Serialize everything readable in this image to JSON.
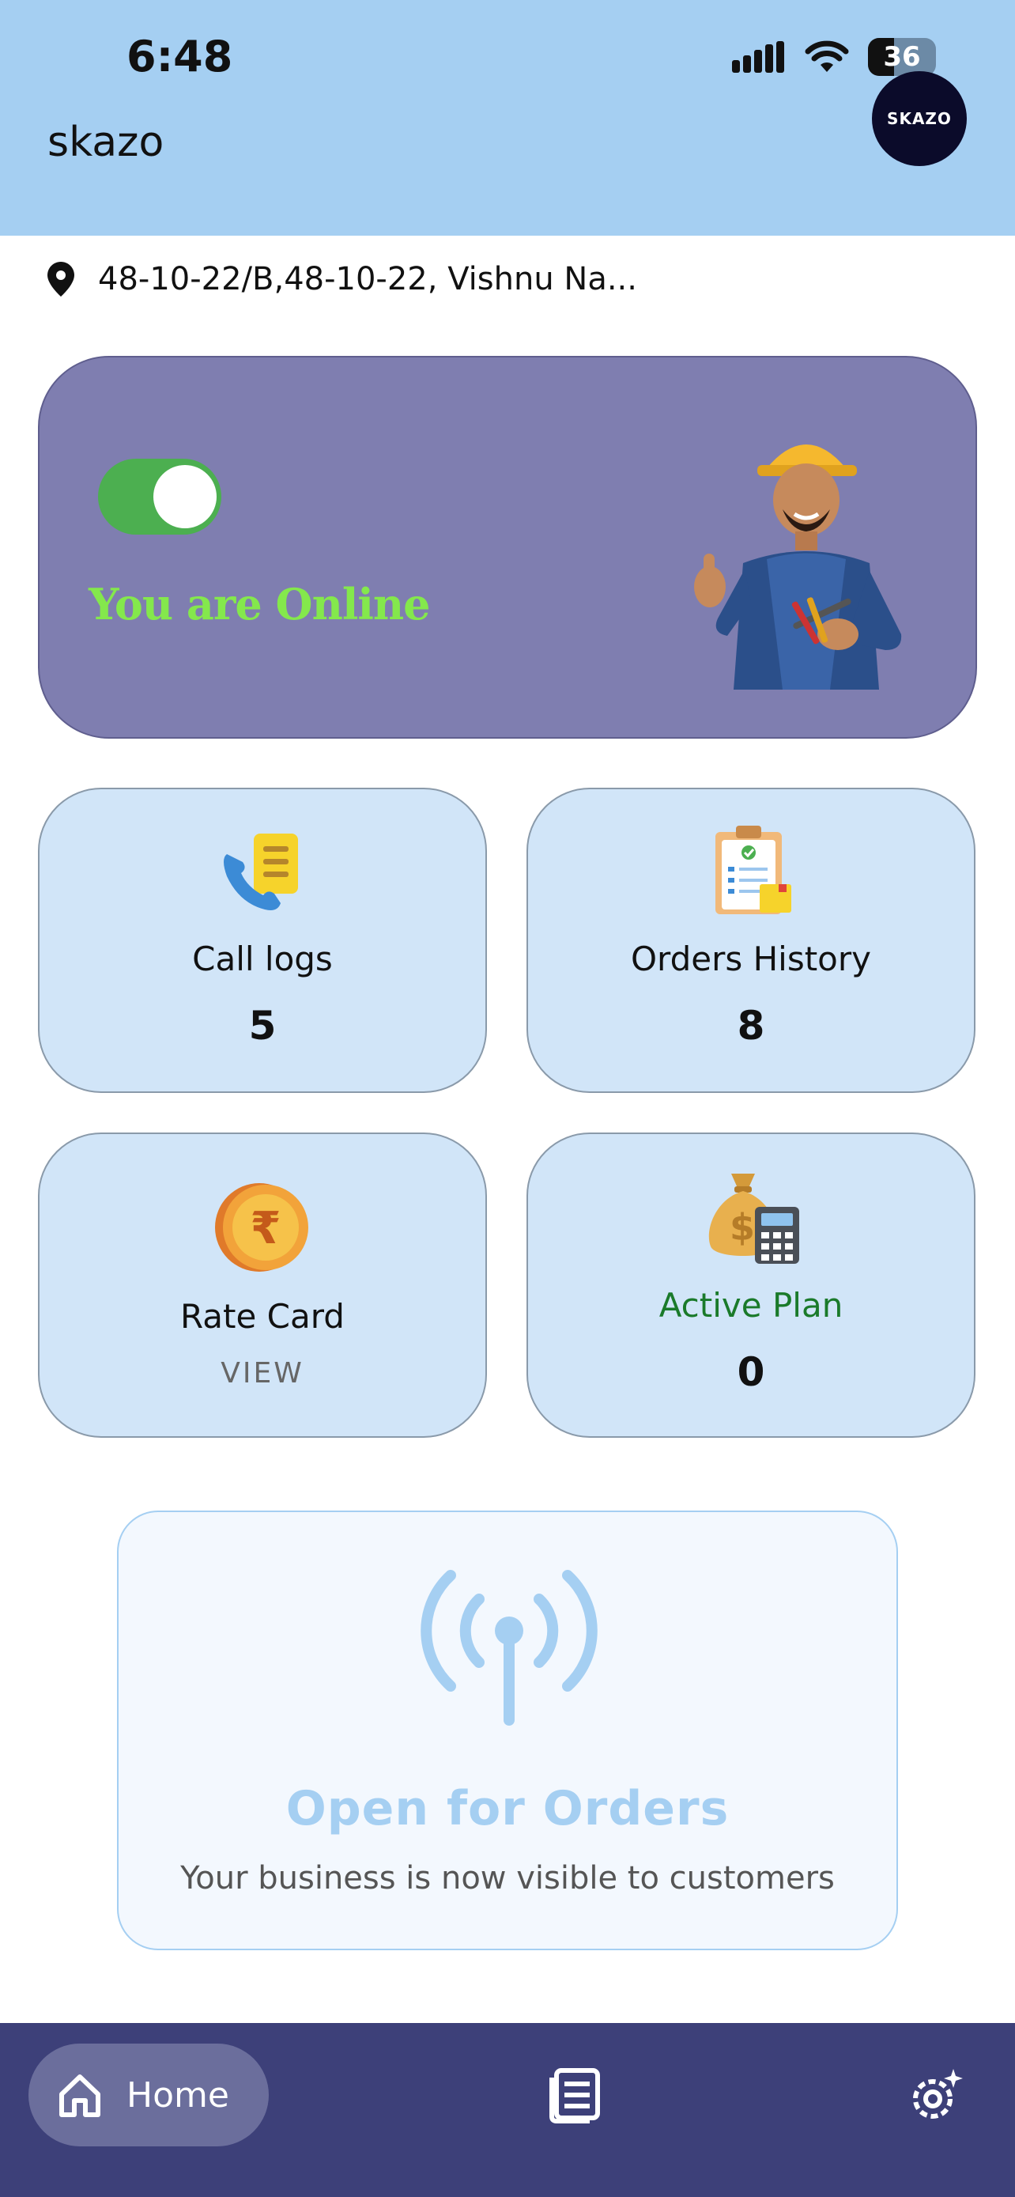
{
  "status_bar": {
    "time": "6:48",
    "battery": "36"
  },
  "header": {
    "title": "skazo",
    "avatar_text": "SKAZO"
  },
  "location": {
    "address": "48-10-22/B,48-10-22, Vishnu Na..."
  },
  "online_card": {
    "status_text": "You are Online",
    "toggle_on": true
  },
  "tiles": {
    "call_logs": {
      "label": "Call logs",
      "count": "5"
    },
    "orders_history": {
      "label": "Orders History",
      "count": "8"
    },
    "rate_card": {
      "label": "Rate Card",
      "action": "VIEW"
    },
    "active_plan": {
      "label": "Active Plan",
      "count": "0"
    }
  },
  "open_orders": {
    "title": "Open for Orders",
    "subtitle": "Your business is now visible to customers"
  },
  "bottom_nav": {
    "home_label": "Home"
  },
  "colors": {
    "header_bg": "#a5cff2",
    "online_card_bg": "#7f7eb0",
    "online_text": "#84e84c",
    "tile_bg": "#d1e5f8",
    "active_plan_label": "#1a7a2a",
    "nav_bg": "#3d4079"
  }
}
